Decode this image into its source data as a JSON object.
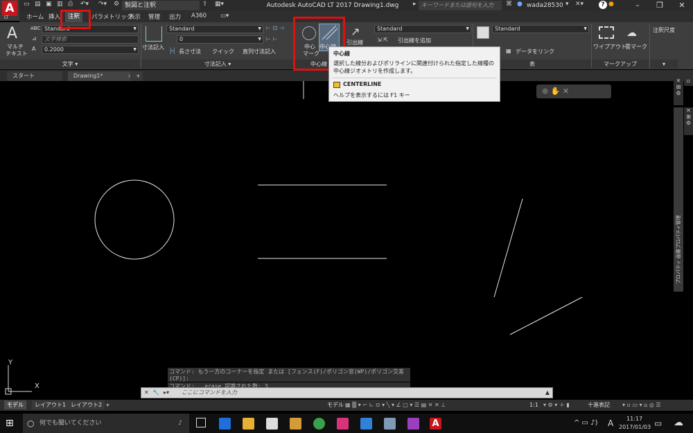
{
  "title_bar": {
    "workspace": "製図と注釈",
    "app_title": "Autodesk AutoCAD LT 2017    Drawing1.dwg",
    "search_placeholder": "キーワードまたは語句を入力",
    "username": "wada28530",
    "app_logo": "A",
    "app_logo_sub": "LT"
  },
  "ribbon_tabs": [
    "ホーム",
    "挿入",
    "注釈",
    "パラメトリック",
    "表示",
    "管理",
    "出力",
    "A360"
  ],
  "ribbon": {
    "text_panel": {
      "multiline_label_1": "マルチ",
      "multiline_label_2": "テキスト",
      "style_combo": "Standard",
      "find_placeholder": "文字検索",
      "height_value": "0.2000",
      "panel_title": "文字 ▾"
    },
    "dim_panel": {
      "dim_button": "寸法記入",
      "style_combo": "Standard",
      "layer_combo": "0",
      "linear_label": "長さ寸法",
      "quick_label": "クイック",
      "continue_label": "直列寸法記入",
      "panel_title": "寸法記入 ▾"
    },
    "centerline_panel": {
      "center_mark_1": "中心",
      "center_mark_2": "マーク",
      "centerline_label": "中心線",
      "panel_title": "中心線"
    },
    "leader_panel": {
      "leader_label": "引出線",
      "style_combo": "Standard",
      "add_leader": "引出線を追加"
    },
    "table_panel": {
      "style_combo": "Standard",
      "link_label": "データをリンク",
      "panel_title": "表"
    },
    "markup_panel": {
      "wipeout": "ワイプアウト",
      "cloud": "雲マーク",
      "panel_title": "マークアップ"
    },
    "annoscale_label": "注釈尺度"
  },
  "file_tabs": [
    "スタート",
    "Drawing1*"
  ],
  "tooltip": {
    "title": "中心線",
    "description": "選択した線分およびポリラインに関連付けられた指定した線種の中心線ジオメトリを作成します。",
    "command": "CENTERLINE",
    "help": "ヘルプを表示するには F1 キー"
  },
  "command_history": [
    "コマンド: もう一方のコーナーを指定 または [フェンス(F)/ポリゴン窓(WP)/ポリゴン交差(CP)]:",
    "コマンド: _.erase 認識された数: 3"
  ],
  "command_placeholder": "ここにコマンドを入力",
  "layout_tabs": [
    "モデル",
    "レイアウト1",
    "レイアウト2"
  ],
  "status_bar": {
    "model": "モデル",
    "scale": "1:1",
    "units": "十進表記"
  },
  "side_palette_label": "プロパティ 画層プロパティ管理",
  "taskbar": {
    "search_placeholder": "何でも聞いてください",
    "time": "11:17",
    "date": "2017/01/03",
    "ime": "A"
  },
  "ucs": {
    "x_label": "X",
    "y_label": "Y"
  },
  "colors": {
    "highlight": "#e01010",
    "canvas": "#000000",
    "ribbon": "#3e3e3e"
  }
}
